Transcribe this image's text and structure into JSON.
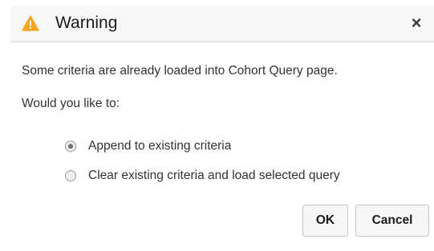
{
  "dialog": {
    "title": "Warning",
    "close_label": "×",
    "message": "Some criteria are already loaded into Cohort Query page.",
    "prompt": "Would you like to:",
    "options": [
      {
        "label": "Append to existing criteria",
        "selected": true
      },
      {
        "label": "Clear existing criteria and load selected query",
        "selected": false
      }
    ],
    "buttons": {
      "ok": "OK",
      "cancel": "Cancel"
    }
  },
  "colors": {
    "warning_icon": "#f5a623",
    "titlebar_bg": "#f7f7f7",
    "text": "#333333"
  },
  "icons": {
    "title_icon": "warning-triangle-icon",
    "close_icon": "close-icon"
  }
}
